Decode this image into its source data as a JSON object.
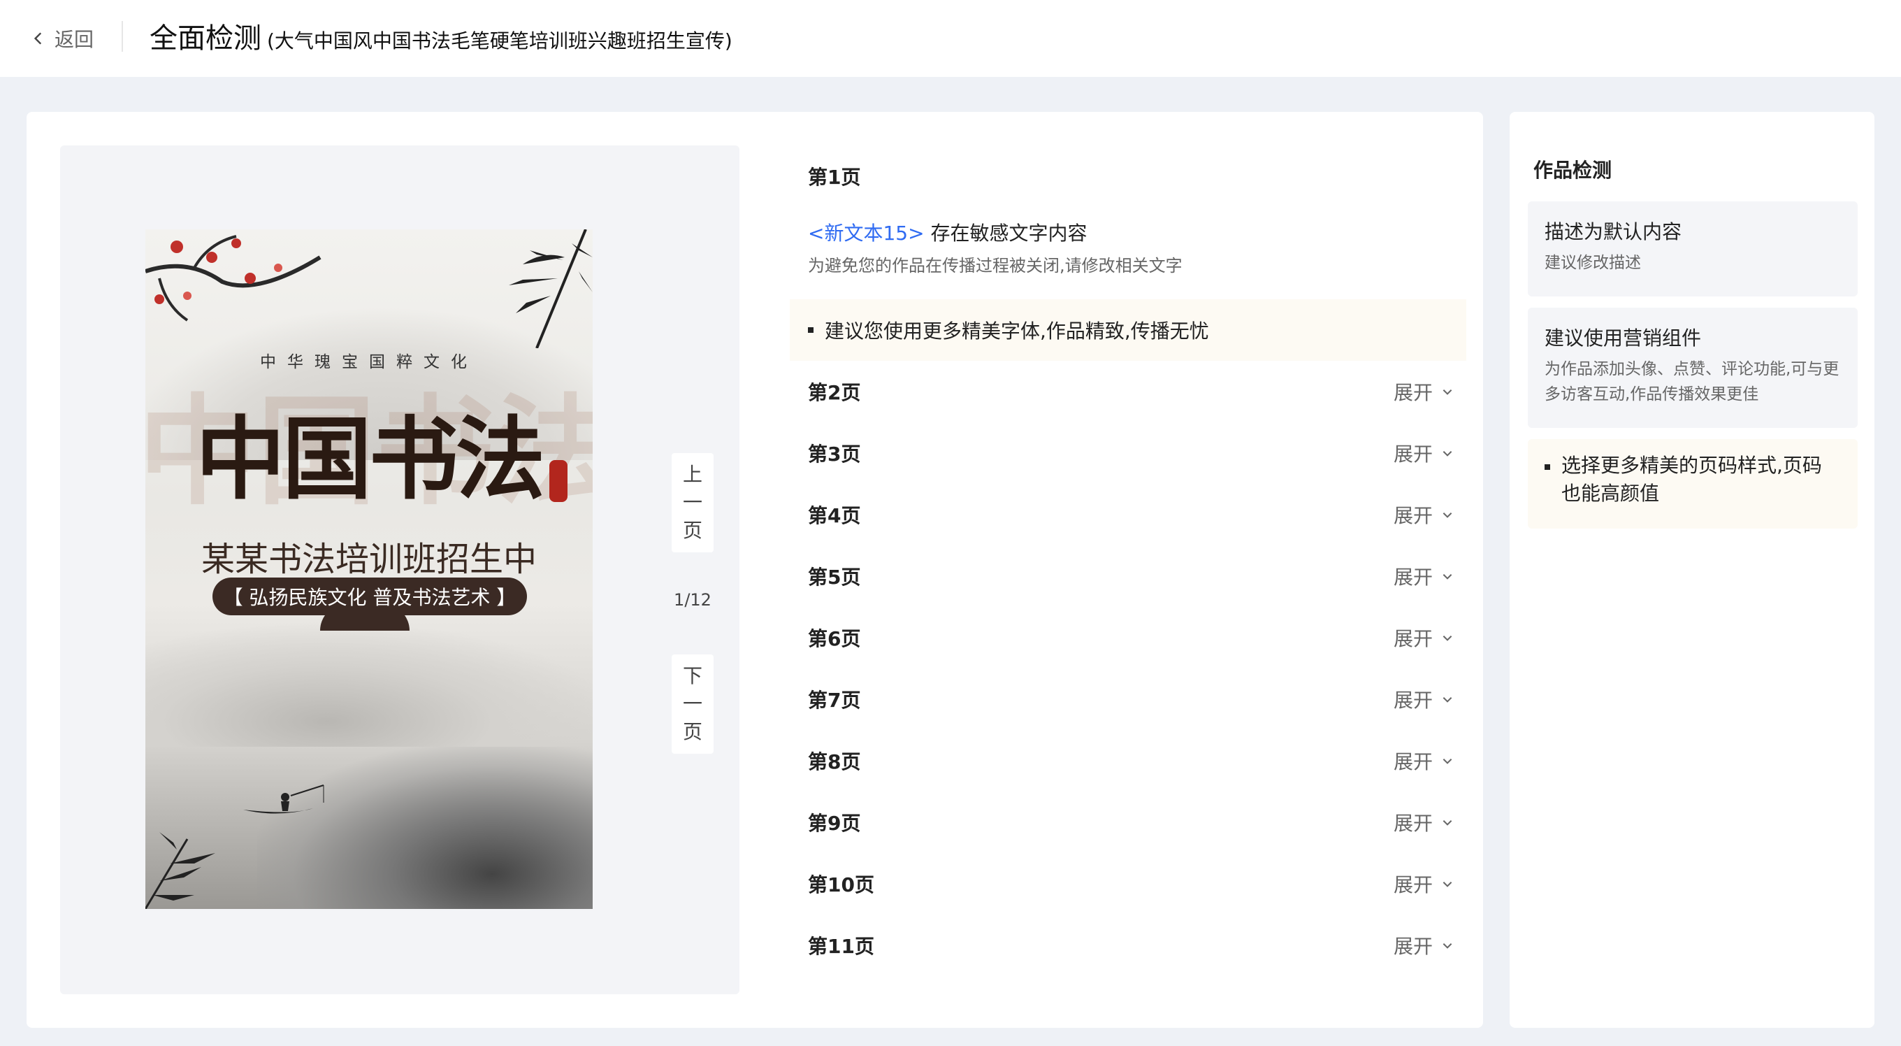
{
  "header": {
    "back_label": "返回",
    "title": "全面检测",
    "subtitle": "(大气中国风中国书法毛笔硬笔培训班兴趣班招生宣传)"
  },
  "preview": {
    "poster": {
      "tagline": "中华瑰宝国粹文化",
      "headline": "中国书法",
      "subheadline": "某某书法培训班招生中",
      "pill_text": "【 弘扬民族文化 普及书法艺术 】"
    },
    "prev_label": [
      "上",
      "一",
      "页"
    ],
    "next_label": [
      "下",
      "一",
      "页"
    ],
    "page_indicator": "1/12"
  },
  "results": {
    "page1": {
      "title": "第1页",
      "issue_link": "<新文本15>",
      "issue_text": " 存在敏感文字内容",
      "issue_desc": "为避免您的作品在传播过程被关闭,请修改相关文字",
      "tip": "建议您使用更多精美字体,作品精致,传播无忧"
    },
    "expand_label": "展开",
    "pages": [
      "第2页",
      "第3页",
      "第4页",
      "第5页",
      "第6页",
      "第7页",
      "第8页",
      "第9页",
      "第10页",
      "第11页"
    ]
  },
  "side": {
    "title": "作品检测",
    "cards": [
      {
        "heading": "描述为默认内容",
        "desc": "建议修改描述"
      },
      {
        "heading": "建议使用营销组件",
        "desc": "为作品添加头像、点赞、评论功能,可与更多访客互动,作品传播效果更佳"
      }
    ],
    "tip": "选择更多精美的页码样式,页码也能高颜值"
  },
  "colors": {
    "link": "#2f6bf2",
    "tip_bg": "#fdfaf3",
    "page_bg": "#eef1f6"
  }
}
